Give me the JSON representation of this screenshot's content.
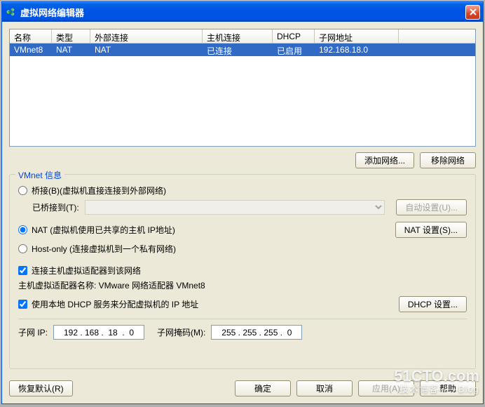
{
  "title": "虚拟网络编辑器",
  "close_label": "×",
  "columns": {
    "name": "名称",
    "type": "类型",
    "ext": "外部连接",
    "host": "主机连接",
    "dhcp": "DHCP",
    "subnet": "子网地址"
  },
  "rows": [
    {
      "name": "VMnet8",
      "type": "NAT",
      "ext": "NAT",
      "host": "已连接",
      "dhcp": "已启用",
      "subnet": "192.168.18.0"
    }
  ],
  "buttons": {
    "add_net": "添加网络...",
    "remove_net": "移除网络",
    "auto_set": "自动设置(U)...",
    "nat_set": "NAT 设置(S)...",
    "dhcp_set": "DHCP 设置...",
    "restore": "恢复默认(R)",
    "ok": "确定",
    "cancel": "取消",
    "apply": "应用(A)",
    "help": "帮助"
  },
  "group": {
    "legend": "VMnet 信息",
    "bridged_label": "桥接(B)(虚拟机直接连接到外部网络)",
    "bridged_to": "已桥接到(T):",
    "nat_label": "NAT (虚拟机使用已共享的主机 IP地址)",
    "hostonly_label": "Host-only (连接虚拟机到一个私有网络)",
    "connect_host_label": "连接主机虚拟适配器到该网络",
    "adapter_name_label": "主机虚拟适配器名称: VMware 网络适配器 VMnet8",
    "use_dhcp_label": "使用本地 DHCP 服务来分配虚拟机的 IP 地址",
    "subnet_ip_label": "子网 IP:",
    "subnet_mask_label": "子网掩码(M):"
  },
  "values": {
    "subnet_ip": "192 . 168 .  18  .  0",
    "subnet_mask": "255 . 255 . 255 .  0"
  },
  "watermark": {
    "main": "51CTO.com",
    "sub": "技术博客——Blog"
  }
}
